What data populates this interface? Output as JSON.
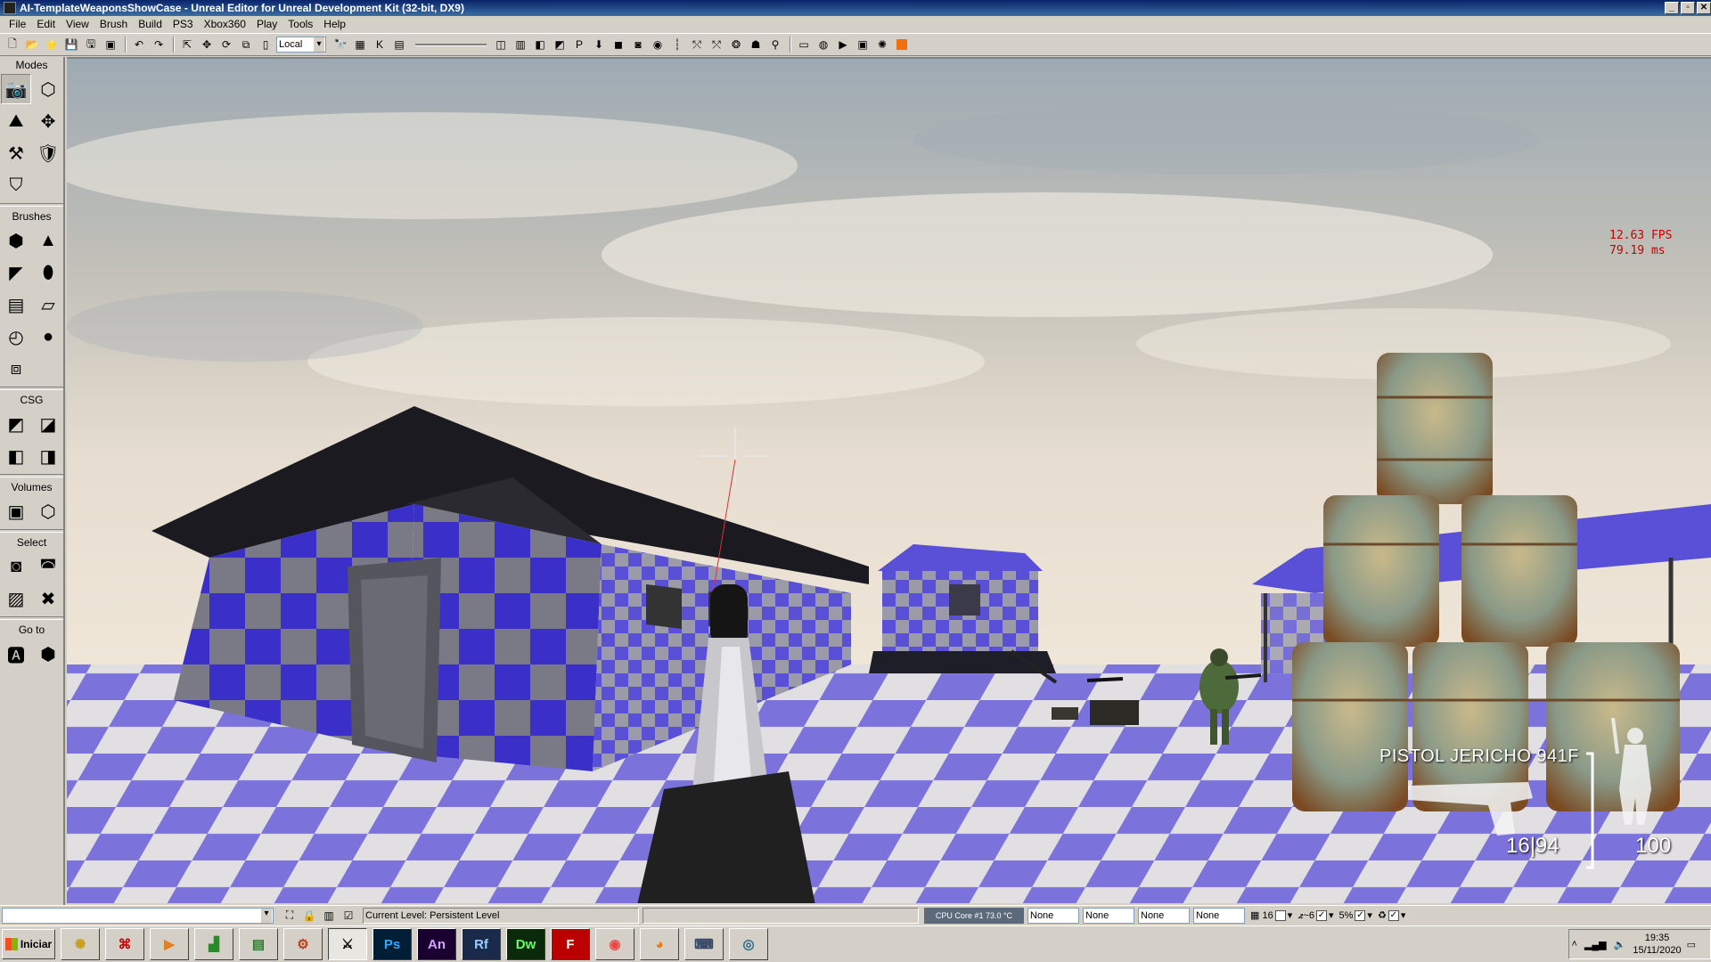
{
  "window": {
    "title": "AI-TemplateWeaponsShowCase - Unreal Editor for Unreal Development Kit (32-bit, DX9)",
    "min_label": "_",
    "max_label": "▫",
    "close_label": "✕"
  },
  "menu": [
    "File",
    "Edit",
    "View",
    "Brush",
    "Build",
    "PS3",
    "Xbox360",
    "Play",
    "Tools",
    "Help"
  ],
  "toolbar": {
    "coord_system": "Local"
  },
  "modes_panel": {
    "modes_label": "Modes",
    "brushes_label": "Brushes",
    "csg_label": "CSG",
    "volumes_label": "Volumes",
    "select_label": "Select",
    "goto_label": "Go to"
  },
  "viewport": {
    "fps": "12.63 FPS",
    "frame_time": "79.19 ms",
    "hud": {
      "weapon_name": "PISTOL JERICHO 941F",
      "ammo": "16|94",
      "health": "100"
    }
  },
  "statusbar": {
    "current_level": "Current Level:  Persistent Level",
    "cpu": "CPU Core #1   73.0 °C",
    "fields": [
      "None",
      "None",
      "None",
      "None"
    ],
    "grid_size": "16",
    "rotation_snap": "6",
    "scale_snap": "5%"
  },
  "taskbar": {
    "start_label": "Iniciar",
    "apps": [
      "Ps",
      "An",
      "Rf",
      "Dw"
    ],
    "time": "19:35",
    "date": "15/11/2020"
  },
  "colors": {
    "titlebar": "#0a246a",
    "chrome": "#d4d0c8",
    "fps_text": "#c80000",
    "floor_blue": "#6a5fd6",
    "building_blue": "#3a2fc8"
  }
}
